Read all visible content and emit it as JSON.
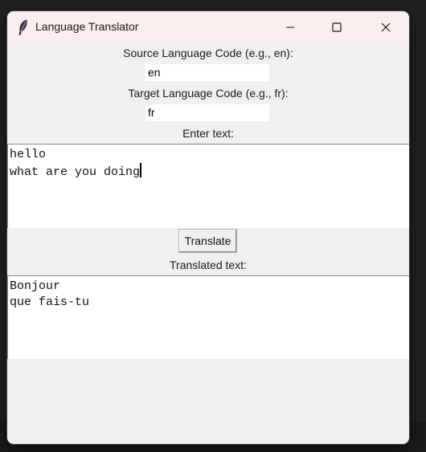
{
  "window": {
    "title": "Language Translator"
  },
  "form": {
    "source_label": "Source Language Code (e.g., en):",
    "source_value": "en",
    "target_label": "Target Language Code (e.g., fr):",
    "target_value": "fr",
    "input_label": "Enter text:",
    "input_lines": [
      "hello",
      "what are you doing"
    ],
    "translate_button": "Translate",
    "output_label": "Translated text:",
    "output_lines": [
      "Bonjour",
      "que fais-tu"
    ]
  }
}
